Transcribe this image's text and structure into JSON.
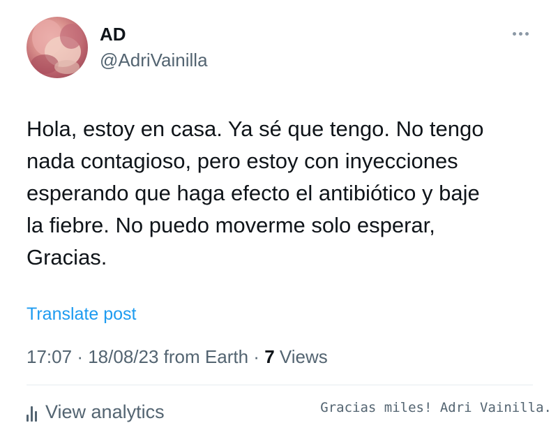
{
  "user": {
    "display_name": "AD",
    "handle": "@AdriVainilla"
  },
  "tweet": {
    "text": "Hola, estoy en casa. Ya sé que tengo. No tengo\nnada contagioso, pero estoy con inyecciones\nesperando que haga efecto el antibiótico y baje\nla fiebre. No puedo moverme solo esperar,\nGracias.",
    "translate_label": "Translate post"
  },
  "meta": {
    "time": "17:07",
    "separator": "·",
    "date": "18/08/23",
    "source": "from Earth",
    "views_count": "7",
    "views_label": "Views"
  },
  "actions": {
    "analytics_label": "View analytics",
    "more_icon": "more-horizontal-icon",
    "analytics_icon": "bar-chart-icon"
  },
  "watermark": "Gracias miles! Adri Vainilla.",
  "colors": {
    "link": "#1d9bf0",
    "secondary_text": "#536471",
    "primary_text": "#0f1419",
    "divider": "#e6ecf0"
  }
}
